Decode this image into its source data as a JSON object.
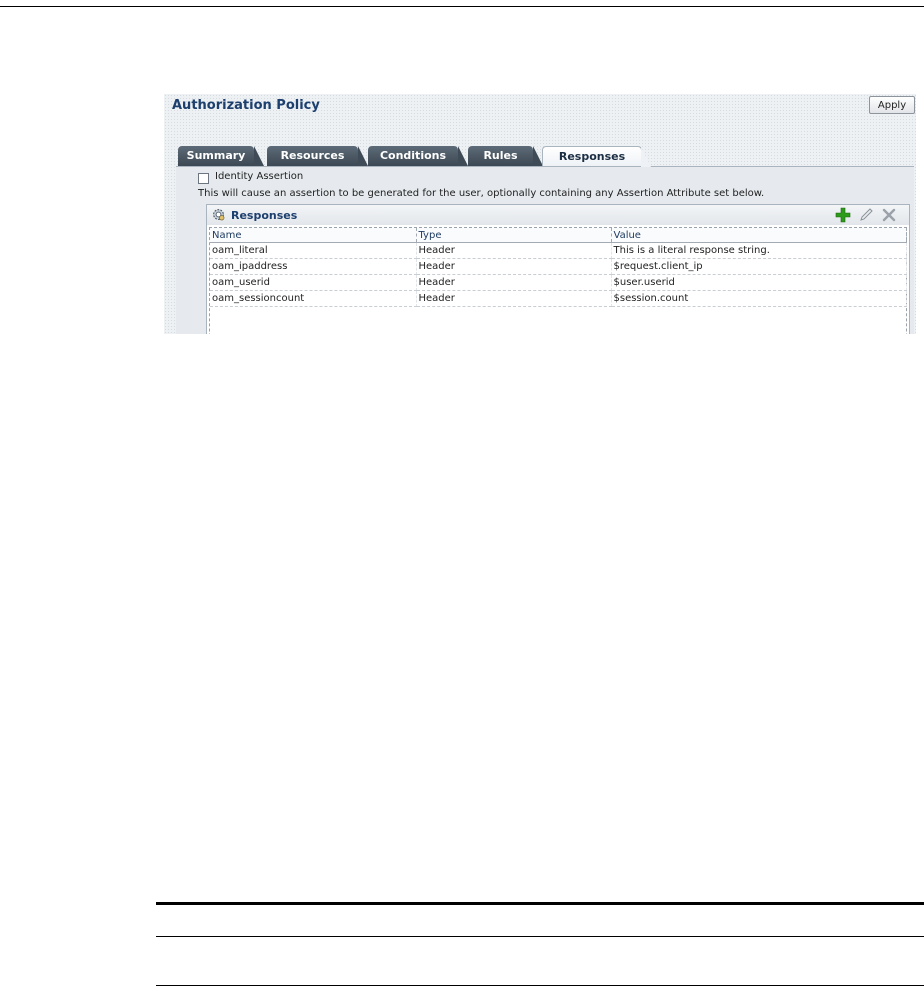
{
  "policy": {
    "title": "Authorization Policy",
    "apply_label": "Apply"
  },
  "tabs": [
    {
      "label": "Summary"
    },
    {
      "label": "Resources"
    },
    {
      "label": "Conditions"
    },
    {
      "label": "Rules"
    },
    {
      "label": "Responses",
      "active": true
    }
  ],
  "identity_assertion": {
    "label": "Identity Assertion",
    "checked": false,
    "description": "This will cause an assertion to be generated for the user, optionally containing any Assertion Attribute set below."
  },
  "responses": {
    "title": "Responses",
    "icons": [
      "gear-icon",
      "add-icon",
      "edit-icon",
      "delete-icon"
    ],
    "columns": [
      "Name",
      "Type",
      "Value"
    ],
    "rows": [
      [
        "oam_literal",
        "Header",
        "This is a literal response string."
      ],
      [
        "oam_ipaddress",
        "Header",
        "$request.client_ip"
      ],
      [
        "oam_userid",
        "Header",
        "$user.userid"
      ],
      [
        "oam_sessioncount",
        "Header",
        "$session.count"
      ]
    ]
  },
  "colors": {
    "title": "#1c3f6e",
    "tab_inactive": "#3c4853",
    "add_icon": "#2e9a1a"
  }
}
